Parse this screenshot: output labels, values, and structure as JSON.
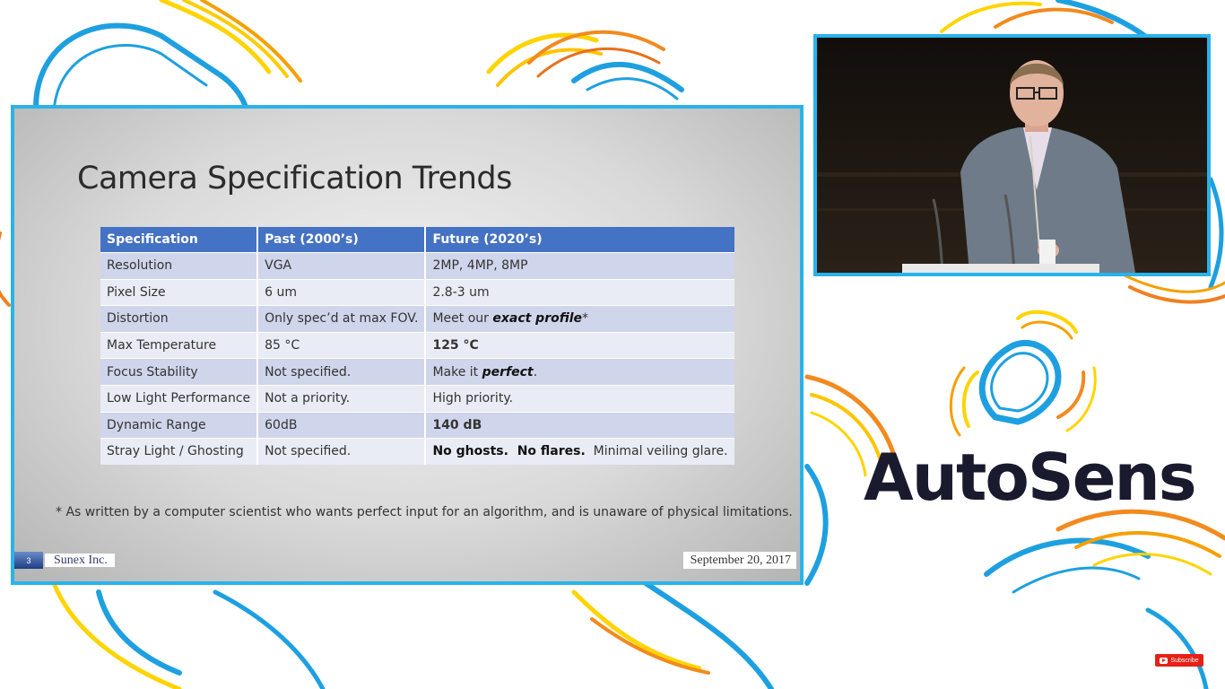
{
  "slide": {
    "title": "Camera Specification Trends",
    "table": {
      "headers": [
        "Specification",
        "Past (2000’s)",
        "Future (2020’s)"
      ],
      "rows": [
        [
          "Resolution",
          "VGA",
          "2MP, 4MP, 8MP"
        ],
        [
          "Pixel Size",
          "6 um",
          "2.8-3 um"
        ],
        [
          "Distortion",
          "Only spec’d at max FOV.",
          "Meet our ",
          "exact profile",
          "*"
        ],
        [
          "Max Temperature",
          "85 °C",
          "125 °C"
        ],
        [
          "Focus Stability",
          "Not specified.",
          "Make it ",
          "perfect",
          "."
        ],
        [
          "Low Light Performance",
          "Not a priority.",
          "High priority."
        ],
        [
          "Dynamic Range",
          "60dB",
          "140 dB"
        ],
        [
          "Stray Light / Ghosting",
          "Not specified.",
          "No ghosts.  No flares.",
          "  Minimal veiling glare."
        ]
      ]
    },
    "footnote": "* As written by a computer scientist who wants perfect input for an algorithm, and is unaware of physical limitations.",
    "page_number": "3",
    "company": "Sunex Inc.",
    "date": "September 20, 2017"
  },
  "brand": {
    "name": "AutoSens"
  },
  "subscribe": {
    "label": "Subscribe"
  },
  "colors": {
    "accent": "#29b3ea",
    "table_header": "#4472c4",
    "highlight_red": "#c00000"
  }
}
